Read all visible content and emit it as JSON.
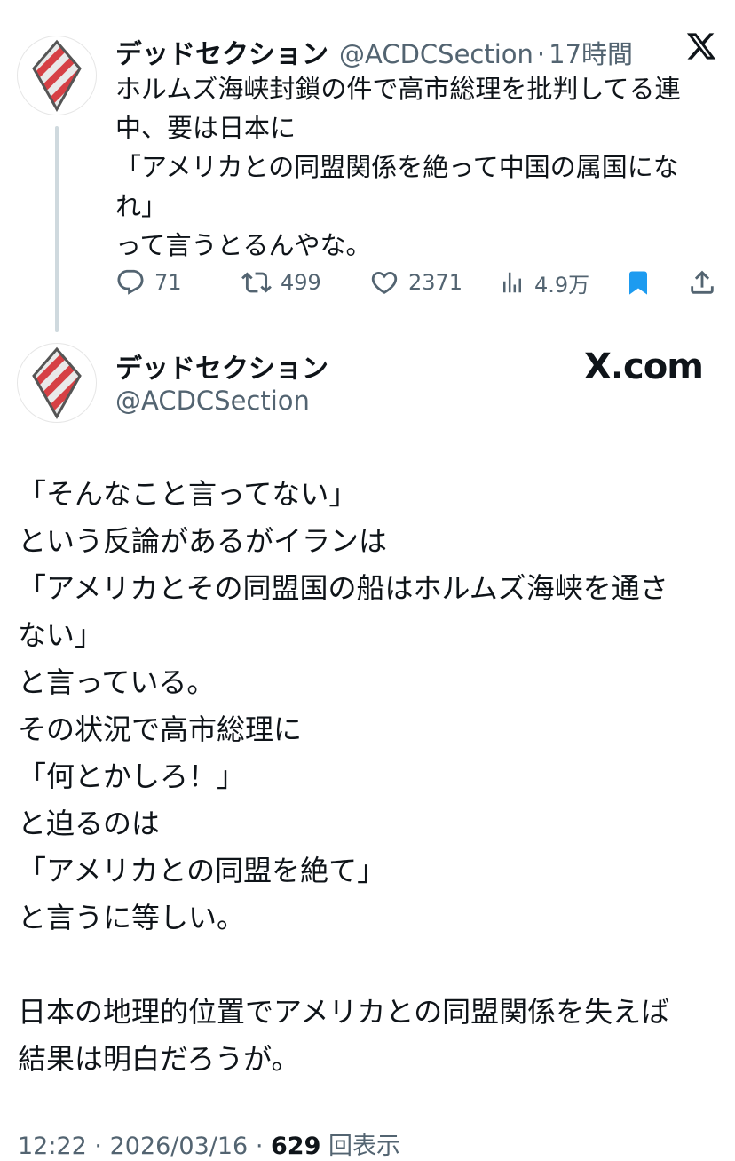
{
  "colors": {
    "accent": "#1d9bf0",
    "muted": "#536471",
    "text": "#0f1419",
    "avatar_stripe": "#d64045"
  },
  "quoted_tweet": {
    "name": "デッドセクション",
    "handle": "@ACDCSection",
    "separator": "·",
    "time": "17時間",
    "text": "ホルムズ海峡封鎖の件で高市総理を批判してる連\n中、要は日本に\n「アメリカとの同盟関係を絶って中国の属国にな\nれ」\nって言うとるんやな。",
    "replies": "71",
    "retweets": "499",
    "likes": "2371",
    "views": "4.9万",
    "close_icon": "x-logo-icon"
  },
  "main_tweet": {
    "name": "デッドセクション",
    "handle": "@ACDCSection",
    "site_label": "X.com",
    "text": "「そんなこと言ってない」\nという反論があるがイランは\n「アメリカとその同盟国の船はホルムズ海峡を通さ\nない」\nと言っている。\nその状況で高市総理に\n「何とかしろ！」\nと迫るのは\n「アメリカとの同盟を絶て」\nと言うに等しい。\n\n日本の地理的位置でアメリカとの同盟関係を失えば\n結果は明白だろうが。",
    "time": "12:22",
    "separator1": "·",
    "date": "2026/03/16",
    "separator2": "·",
    "view_count": "629",
    "view_label": "回表示"
  }
}
